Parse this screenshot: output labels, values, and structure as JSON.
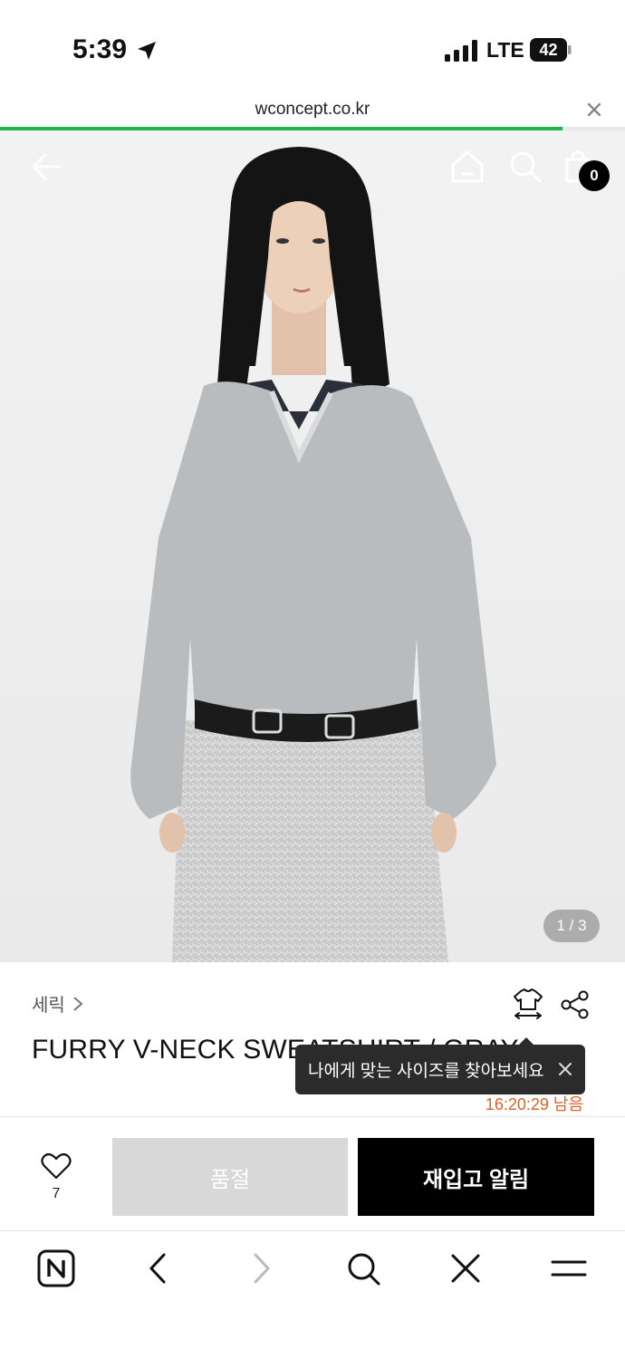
{
  "status": {
    "time": "5:39",
    "network": "LTE",
    "battery": "42"
  },
  "browser": {
    "url": "wconcept.co.kr",
    "load_progress": 0.9
  },
  "gallery": {
    "pager": "1 / 3",
    "cart_count": "0"
  },
  "product": {
    "brand": "세릭",
    "title": "FURRY V-NECK SWEATSHIRT / GRAY",
    "timer": "16:20:29 남음"
  },
  "tooltip": {
    "text": "나에게 맞는 사이즈를 찾아보세요"
  },
  "actions": {
    "like_count": "7",
    "soldout_label": "품절",
    "restock_label": "재입고 알림"
  },
  "icons": {
    "back": "arrow-left-icon",
    "home": "home-icon",
    "search": "search-icon",
    "cart": "shopping-bag-icon",
    "size": "size-guide-icon",
    "share": "share-icon",
    "heart": "heart-icon",
    "naver": "naver-n-icon",
    "nav_back": "chevron-left-icon",
    "nav_forward": "chevron-right-icon",
    "nav_search": "search-icon",
    "nav_close": "close-icon",
    "nav_menu": "menu-icon"
  },
  "colors": {
    "accent_green": "#22b14c",
    "timer_orange": "#e0622a",
    "soldout_gray": "#d8d8d8",
    "restock_black": "#000000"
  }
}
